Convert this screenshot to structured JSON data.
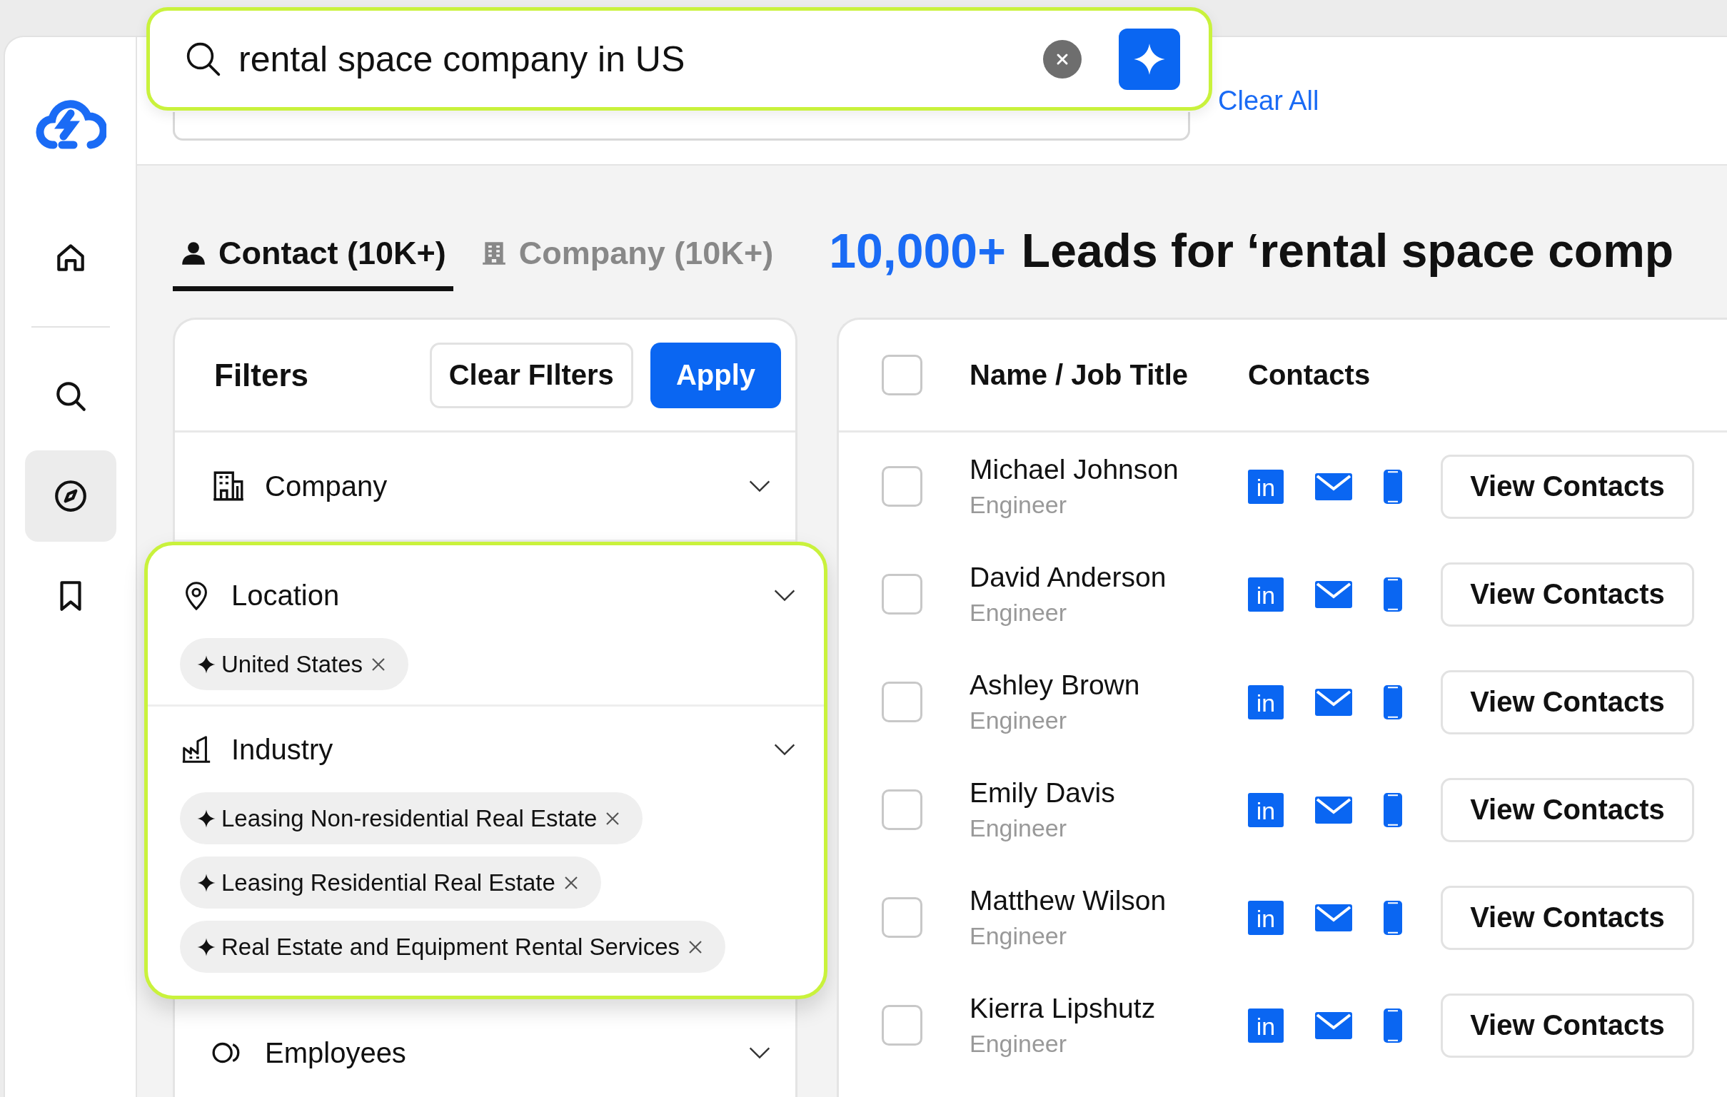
{
  "search": {
    "value": "rental space company in US"
  },
  "header": {
    "clear_all": "Clear All"
  },
  "sidebar": {
    "items": [
      {
        "kind": "home",
        "selected": false
      },
      {
        "kind": "search",
        "selected": false
      },
      {
        "kind": "compass",
        "selected": true
      },
      {
        "kind": "bookmark",
        "selected": false
      }
    ]
  },
  "tabs": [
    {
      "label": "Contact (10K+)",
      "kind": "person",
      "selected": true
    },
    {
      "label": "Company (10K+)",
      "kind": "building",
      "selected": false
    }
  ],
  "results_heading": {
    "count": "10,000+",
    "text": "Leads for ‘rental space comp"
  },
  "filters": {
    "title": "Filters",
    "buttons": [
      {
        "label": "Clear FIlters",
        "kind": "secondary"
      },
      {
        "label": "Apply",
        "kind": "primary"
      }
    ],
    "sections": [
      {
        "label": "Company",
        "kind": "building",
        "highlighted": false
      },
      {
        "label": "Location",
        "kind": "pin",
        "highlighted": true,
        "chips": [
          "United States"
        ]
      },
      {
        "label": "Industry",
        "kind": "factory",
        "highlighted": true,
        "chips": [
          "Leasing Non-residential Real Estate",
          "Leasing Residential Real Estate",
          "Real Estate and Equipment Rental Services"
        ]
      },
      {
        "label": "Employees",
        "kind": "people",
        "highlighted": false
      }
    ]
  },
  "table": {
    "columns": [
      "Name / Job Title",
      "Contacts"
    ],
    "all_checked": false,
    "rows": [
      {
        "name": "Michael Johnson",
        "title": "Engineer",
        "checked": false,
        "linkedin": "in",
        "action": "View Contacts"
      },
      {
        "name": "David Anderson",
        "title": "Engineer",
        "checked": false,
        "linkedin": "in",
        "action": "View Contacts"
      },
      {
        "name": "Ashley Brown",
        "title": "Engineer",
        "checked": false,
        "linkedin": "in",
        "action": "View Contacts"
      },
      {
        "name": "Emily Davis",
        "title": "Engineer",
        "checked": false,
        "linkedin": "in",
        "action": "View Contacts"
      },
      {
        "name": "Matthew Wilson",
        "title": "Engineer",
        "checked": false,
        "linkedin": "in",
        "action": "View Contacts"
      },
      {
        "name": "Kierra Lipshutz",
        "title": "Engineer",
        "checked": false,
        "linkedin": "in",
        "action": "View Contacts"
      }
    ]
  }
}
